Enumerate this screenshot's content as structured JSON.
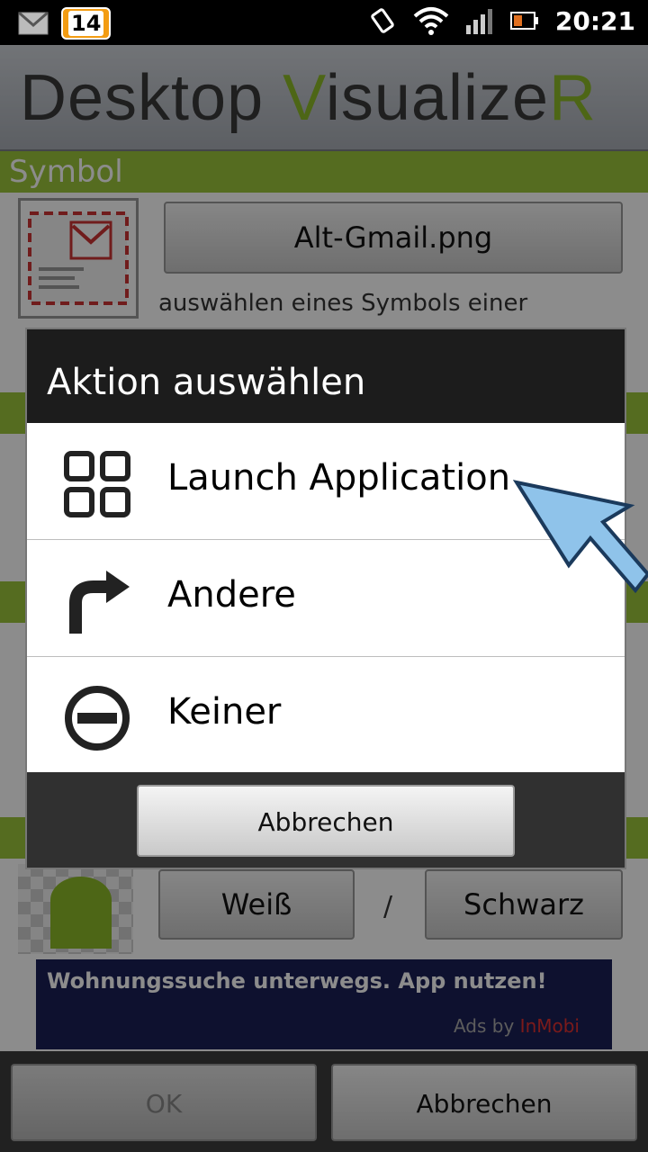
{
  "statusbar": {
    "notification_count": "14",
    "time": "20:21",
    "icons": [
      "gmail-icon",
      "rotate-icon",
      "wifi-icon",
      "signal-icon",
      "battery-icon"
    ]
  },
  "app": {
    "title_part1": "Desktop ",
    "title_part2": "V",
    "title_part3": "isualize",
    "title_part4": "R"
  },
  "symbol_section": {
    "header": "Symbol",
    "file_button": "Alt-Gmail.png",
    "description": "auswählen eines Symbols einer"
  },
  "dialog": {
    "title": "Aktion auswählen",
    "items": [
      {
        "label": "Launch Application",
        "icon": "grid-icon"
      },
      {
        "label": "Andere",
        "icon": "arrow-turn-icon"
      },
      {
        "label": "Keiner",
        "icon": "minus-circle-icon"
      }
    ],
    "cancel": "Abbrechen"
  },
  "color_section": {
    "white_button": "Weiß",
    "separator": "/",
    "black_button": "Schwarz"
  },
  "ad": {
    "text": "Wohnungssuche unterwegs. App nutzen!",
    "by": "Ads by ",
    "brand": "InMobi"
  },
  "bottombar": {
    "ok": "OK",
    "cancel": "Abbrechen"
  },
  "colors": {
    "accent_green": "#9cc53b",
    "ad_background": "#1b1f56",
    "inmobi_red": "#e03131"
  }
}
